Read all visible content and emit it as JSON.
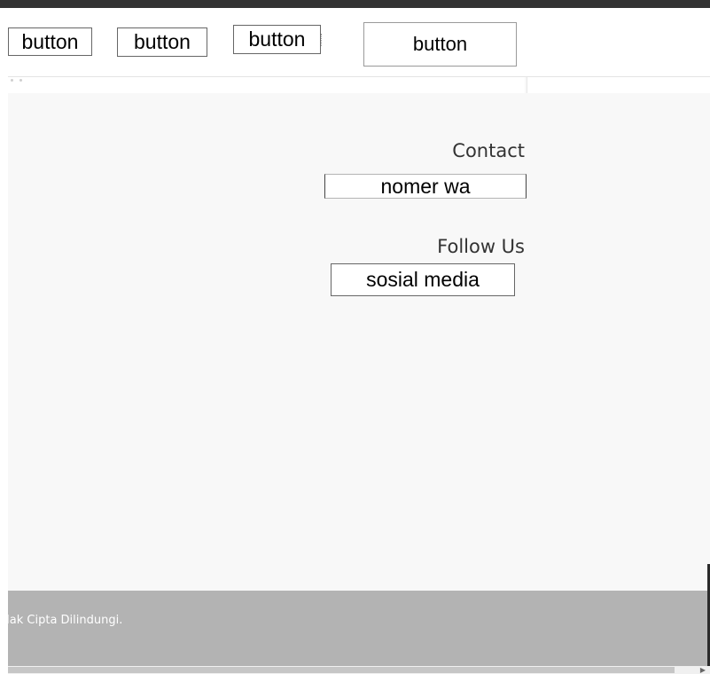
{
  "header": {
    "buttons": [
      "button",
      "button",
      "button",
      "button"
    ]
  },
  "contact": {
    "heading": "Contact",
    "value": "nomer wa"
  },
  "follow": {
    "heading": "Follow Us",
    "value": "sosial media"
  },
  "footer": {
    "text": "Hak Cipta Dilindungi."
  },
  "scrollbar": {
    "arrow_icon": "chevron-right-icon"
  },
  "colors": {
    "topbar": "#333333",
    "page_bg": "#f8f8f8",
    "footer_bg": "#b3b3b3"
  }
}
